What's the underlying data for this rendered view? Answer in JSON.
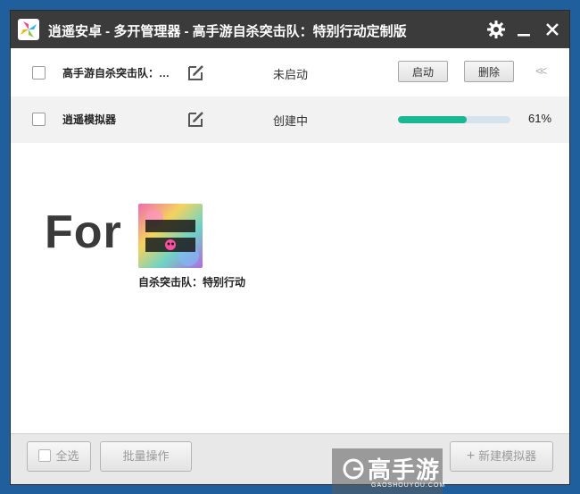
{
  "window": {
    "title": "逍遥安卓 - 多开管理器 - 高手游自杀突击队：特别行动定制版",
    "icons": {
      "app": "app-logo-icon",
      "settings": "gear-icon",
      "minimize": "minimize-icon",
      "close": "close-icon"
    }
  },
  "instances": [
    {
      "name": "高手游自杀突击队：…",
      "status": "未启动",
      "start_label": "启动",
      "delete_label": "删除",
      "collapse_label": "<<"
    },
    {
      "name": "逍遥模拟器",
      "status": "创建中",
      "progress": 0.61,
      "percent_label": "61%"
    }
  ],
  "promo": {
    "big_text": "For",
    "game_caption": "自杀突击队：特别行动"
  },
  "footer": {
    "select_all_label": "全选",
    "batch_label": "批量操作",
    "new_label": "新建模拟器"
  },
  "watermark": {
    "text": "高手游",
    "sub": "GAOSHOUYOU.COM"
  },
  "colors": {
    "titlebar": "#3b3b3b",
    "progress": "#18b895",
    "desktop": "#1f5f9e"
  }
}
